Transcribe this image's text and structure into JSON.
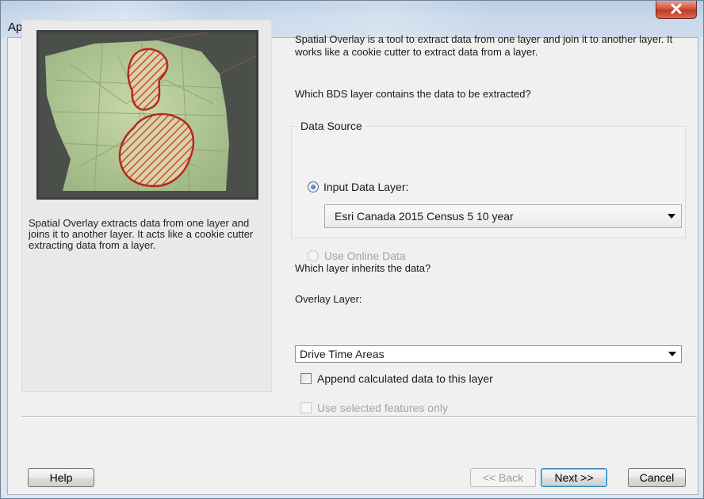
{
  "window": {
    "title": "Append Data",
    "close_icon": "close-icon"
  },
  "left_panel": {
    "description": "Spatial Overlay extracts data from one layer and joins it to another layer. It acts like a cookie cutter extracting data from a layer.",
    "image": "spatial-overlay-map-illustration"
  },
  "intro": {
    "text": "Spatial Overlay is a tool to extract data from one layer and join it to another layer.  It works like a cookie cutter to extract data from a layer."
  },
  "question_source": "Which BDS layer contains the data to be extracted?",
  "data_source": {
    "legend": "Data Source",
    "input_layer_label": "Input Data Layer:",
    "input_layer_checked": true,
    "input_layer_value": "Esri Canada 2015 Census 5 10 year",
    "online_label": "Use Online Data",
    "online_checked": false,
    "online_enabled": false
  },
  "question_target": "Which layer inherits the data?",
  "overlay": {
    "label": "Overlay Layer:",
    "value": "Drive Time Areas"
  },
  "options": {
    "append_label": "Append calculated data to this layer",
    "append_checked": false,
    "selected_label": "Use selected features only",
    "selected_checked": false,
    "selected_enabled": false
  },
  "buttons": {
    "help": "Help",
    "back": "<< Back",
    "next": "Next >>",
    "cancel": "Cancel"
  },
  "colors": {
    "close_button": "#c13d25",
    "overlay_hatch": "#c0392b",
    "map_land": "#b9cf9a"
  }
}
